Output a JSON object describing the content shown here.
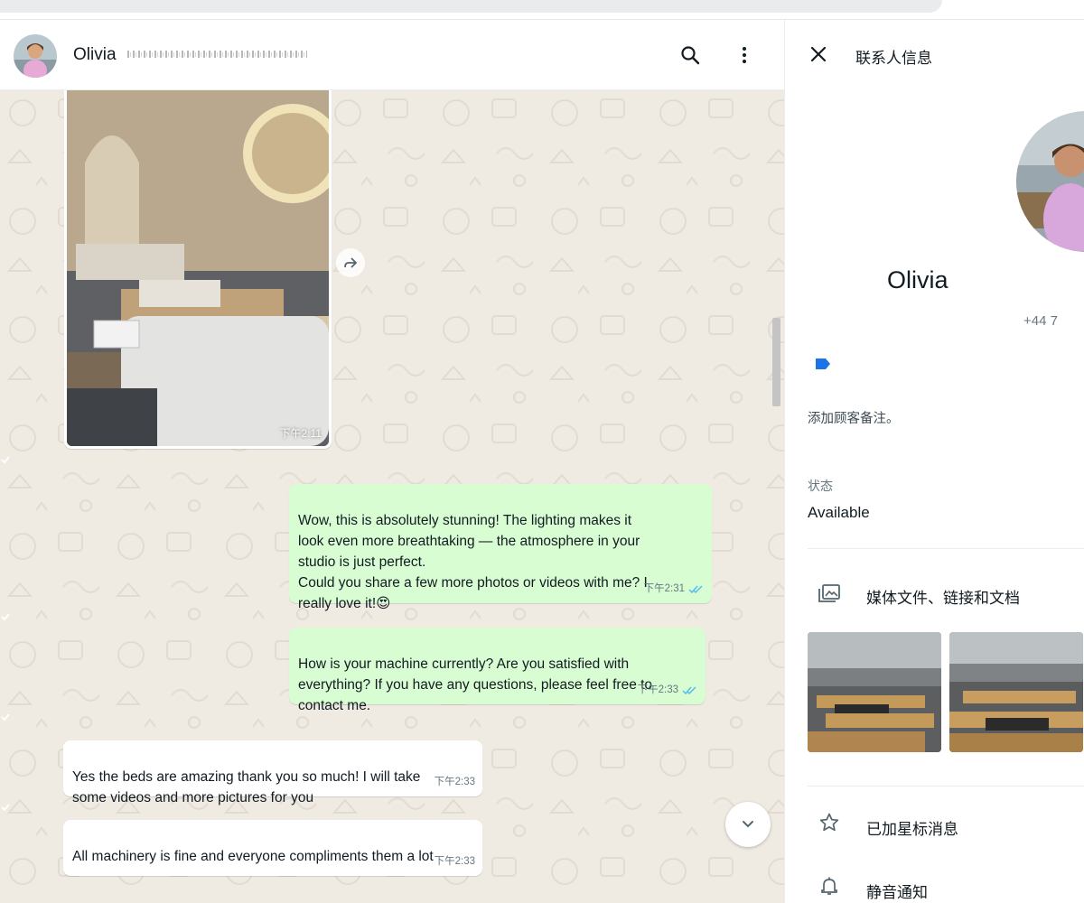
{
  "chat": {
    "contact_name": "Olivia",
    "messages": [
      {
        "direction": "incoming",
        "type": "image",
        "time": "下午2:11"
      },
      {
        "direction": "outgoing",
        "text": "Wow, this is absolutely stunning! The lighting makes it\nlook even more breathtaking — the atmosphere in your\nstudio is just perfect.\nCould you share a few more photos or videos with me? I\nreally love it!😍",
        "time": "下午2:31",
        "status": "read"
      },
      {
        "direction": "outgoing",
        "text": "How is your machine currently? Are you satisfied with\neverything? If you have any questions, please feel free to\ncontact me.",
        "time": "下午2:33",
        "status": "read"
      },
      {
        "direction": "incoming",
        "text": "Yes the beds are amazing thank you so much! I will take\nsome videos  and more pictures for you",
        "time": "下午2:33"
      },
      {
        "direction": "incoming",
        "text": "All machinery is fine and everyone compliments them a lot",
        "time": "下午2:33"
      }
    ]
  },
  "info_panel": {
    "title": "联系人信息",
    "name": "Olivia",
    "phone": "+44 7",
    "note_placeholder": "添加顾客备注。",
    "status_label": "状态",
    "status_value": "Available",
    "media_label": "媒体文件、链接和文档",
    "starred_label": "已加星标消息",
    "mute_label": "静音通知"
  },
  "icons": {
    "header": [
      "search-icon",
      "kebab-menu-icon"
    ],
    "info": [
      "close-icon",
      "label-tag-icon",
      "media-icon",
      "star-icon",
      "bell-icon"
    ],
    "chat": [
      "forward-icon",
      "chevron-down-icon",
      "double-check-icon"
    ]
  },
  "colors": {
    "outgoing_bubble": "#d9fdd3",
    "incoming_bubble": "#ffffff",
    "chat_background": "#efeae2",
    "read_ticks": "#53bdeb",
    "label_tag": "#1a73e8"
  }
}
